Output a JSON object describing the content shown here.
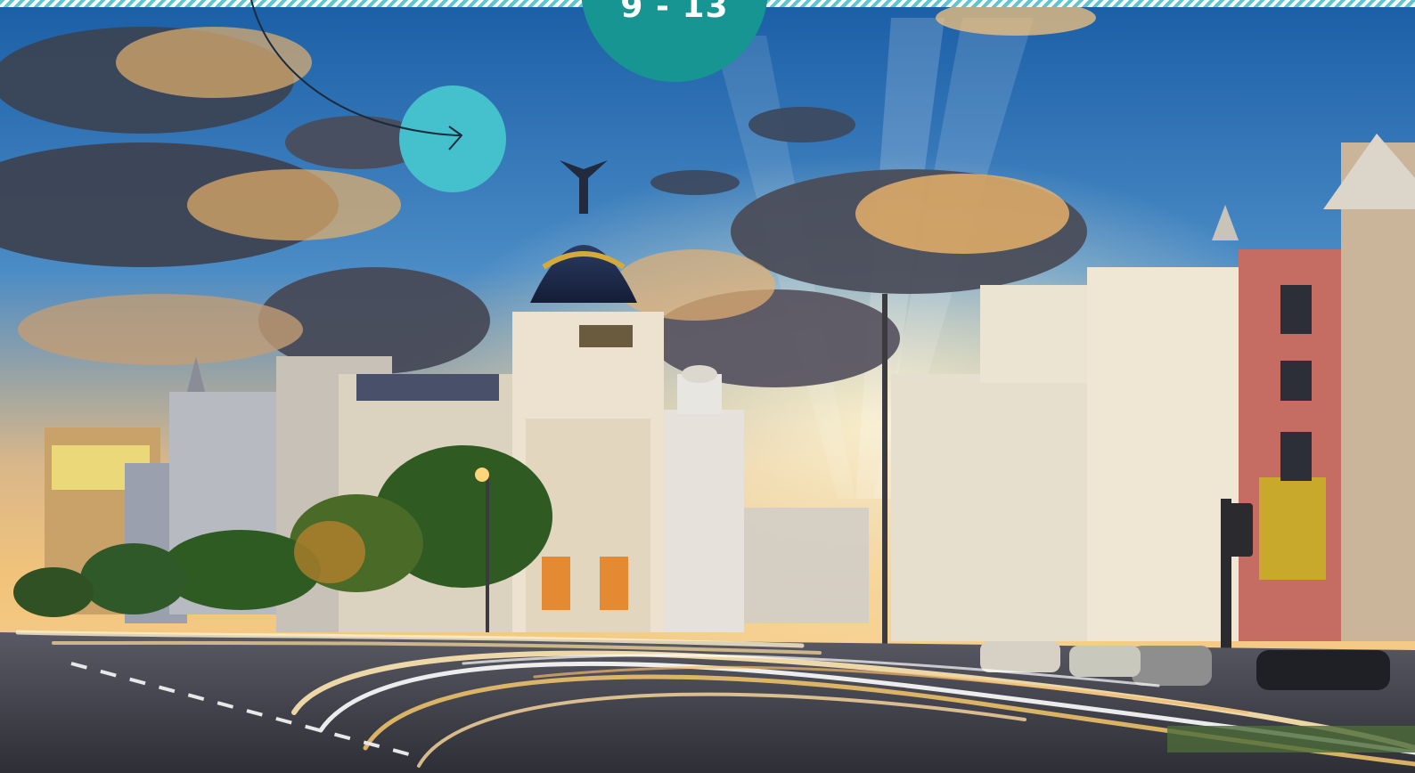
{
  "badge": {
    "date_range": "9 - 13"
  },
  "nav": {
    "next_icon": "arrow-right-icon"
  },
  "photo": {
    "description_icon": "madrid-gran-via-photo"
  },
  "colors": {
    "badge": "#179592",
    "next_button": "#44c1cc",
    "stripe": "#5cc6d1",
    "arrow": "#1b2b3d"
  }
}
